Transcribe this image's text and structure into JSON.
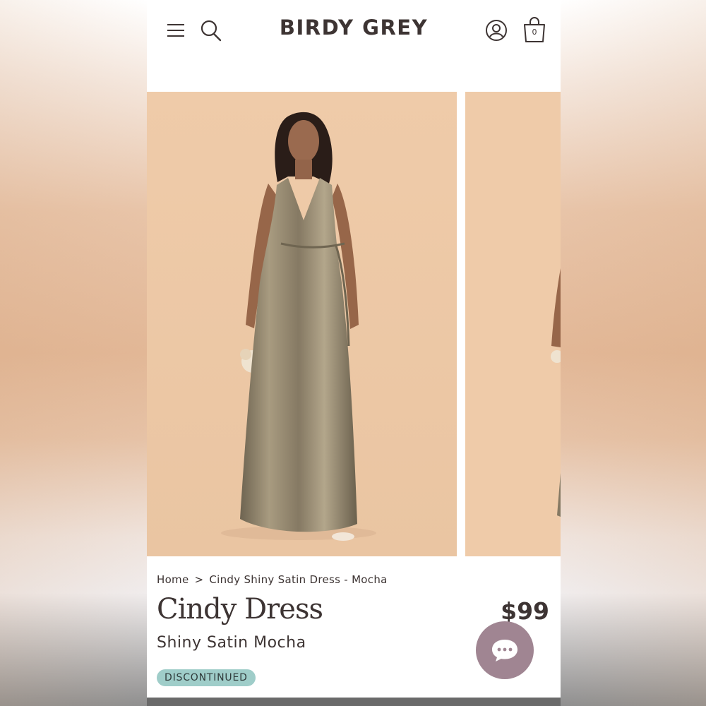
{
  "header": {
    "brand": "BIRDY GREY",
    "cart_count": "0",
    "icons": [
      "hamburger-menu-icon",
      "search-icon",
      "account-icon",
      "shopping-bag-icon"
    ]
  },
  "gallery": {
    "slides": [
      "product-photo-1",
      "product-photo-2"
    ]
  },
  "breadcrumb": {
    "home": "Home",
    "separator": ">",
    "current": "Cindy Shiny Satin Dress - Mocha"
  },
  "product": {
    "name": "Cindy Dress",
    "variant": "Shiny Satin Mocha",
    "price": "$99",
    "status_badge": "DISCONTINUED"
  },
  "colors": {
    "brand_text": "#3d3433",
    "photo_background": "#efcba9",
    "dress": "#8c7f67",
    "badge": "#9fcdc9",
    "chat_button": "#a08592"
  }
}
